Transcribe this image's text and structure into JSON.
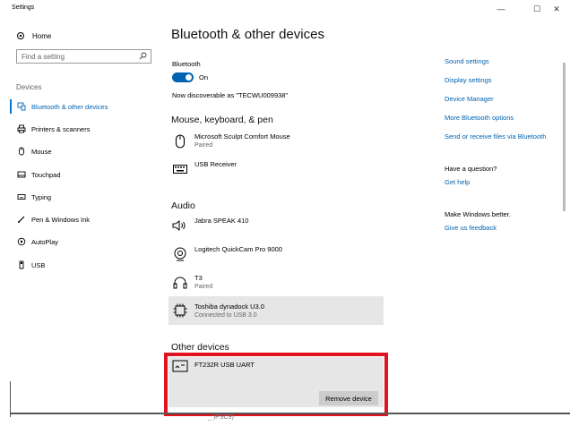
{
  "window": {
    "title": "Settings",
    "controls": {
      "minimize": "—",
      "maximize": "☐",
      "close": "✕"
    }
  },
  "sidebar": {
    "home": "Home",
    "search_placeholder": "Find a setting",
    "section": "Devices",
    "items": [
      {
        "label": "Bluetooth & other devices",
        "icon": "bluetooth-devices-icon",
        "active": true
      },
      {
        "label": "Printers & scanners",
        "icon": "printer-icon"
      },
      {
        "label": "Mouse",
        "icon": "mouse-icon"
      },
      {
        "label": "Touchpad",
        "icon": "touchpad-icon"
      },
      {
        "label": "Typing",
        "icon": "keyboard-icon"
      },
      {
        "label": "Pen & Windows Ink",
        "icon": "pen-icon"
      },
      {
        "label": "AutoPlay",
        "icon": "autoplay-icon"
      },
      {
        "label": "USB",
        "icon": "usb-icon"
      }
    ]
  },
  "main": {
    "title": "Bluetooth & other devices",
    "bluetooth_label": "Bluetooth",
    "toggle_state": "On",
    "discoverable": "Now discoverable as \"TECWU009938\"",
    "section_mouse": "Mouse, keyboard, & pen",
    "mouse_devices": [
      {
        "name": "Microsoft Sculpt Comfort Mouse",
        "status": "Paired",
        "icon": "mouse-icon"
      },
      {
        "name": "USB Receiver",
        "status": "",
        "icon": "keyboard-icon"
      }
    ],
    "section_audio": "Audio",
    "audio_devices": [
      {
        "name": "Jabra SPEAK 410",
        "status": "",
        "icon": "speaker-icon"
      },
      {
        "name": "Logitech QuickCam Pro 9000",
        "status": "",
        "icon": "webcam-icon"
      },
      {
        "name": "T3",
        "status": "Paired",
        "icon": "headset-icon"
      },
      {
        "name": "Toshiba dynadock U3.0",
        "status": "Connected to USB 3.0",
        "icon": "chip-icon"
      }
    ],
    "section_other": "Other devices",
    "other_device": {
      "name": "FT232R USB UART",
      "icon": "device-icon"
    },
    "remove_button": "Remove device",
    "cut_text": "_ )PSC9)"
  },
  "related": {
    "links": [
      "Sound settings",
      "Display settings",
      "Device Manager",
      "More Bluetooth options",
      "Send or receive files via Bluetooth"
    ],
    "question": "Have a question?",
    "help": "Get help",
    "better": "Make Windows better.",
    "feedback": "Give us feedback"
  },
  "colors": {
    "accent": "#0063b1",
    "highlight_box": "#e0141e",
    "selected_bg": "#e6e6e6"
  }
}
